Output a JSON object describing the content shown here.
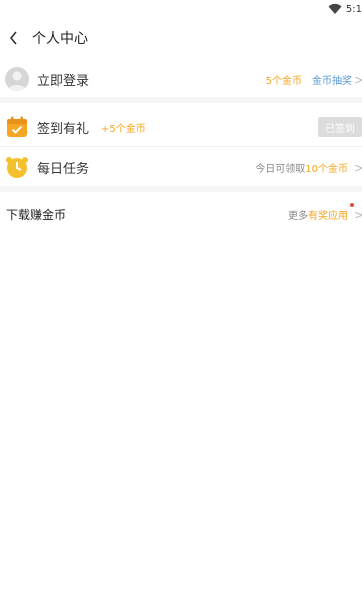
{
  "status_bar": {
    "time": "5:1",
    "wifi_icon": "wifi-icon"
  },
  "header": {
    "back_icon": "chevron-left-icon",
    "title": "个人中心"
  },
  "login_row": {
    "avatar_icon": "avatar-placeholder-icon",
    "label": "立即登录",
    "coins_text": "5个金币",
    "lottery_link": "金币抽奖",
    "chevron": ">"
  },
  "checkin_row": {
    "icon": "calendar-check-icon",
    "label": "签到有礼",
    "reward": "+5个金币",
    "button_label": "已签到"
  },
  "task_row": {
    "icon": "clock-icon",
    "label": "每日任务",
    "prefix": "今日可领取",
    "reward": "10个金币",
    "chevron": ">"
  },
  "download_row": {
    "label": "下载赚金币",
    "prefix": "更多",
    "link": "有奖应用",
    "chevron": ">"
  },
  "colors": {
    "accent_orange": "#f5a623",
    "link_blue": "#5a9bd5",
    "disabled_gray": "#dcdcdc",
    "dot_red": "#e54d42"
  }
}
